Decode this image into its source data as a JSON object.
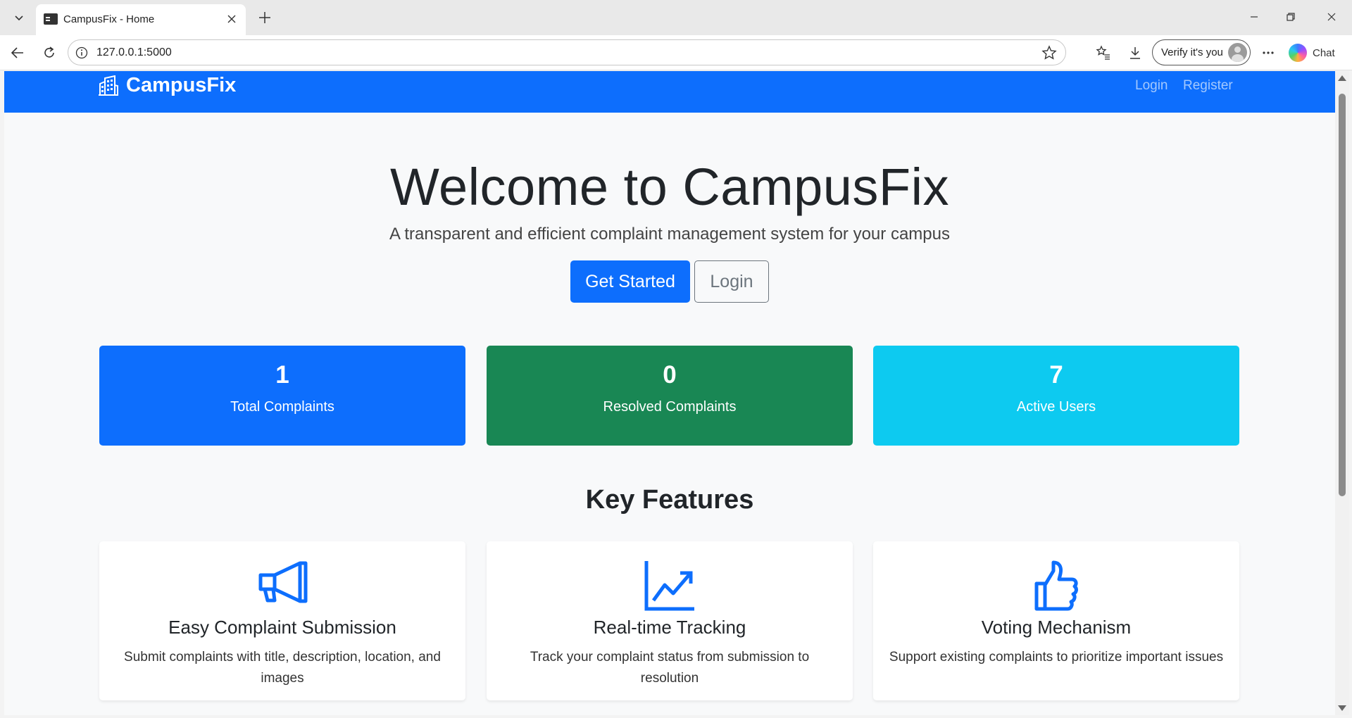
{
  "browser": {
    "tab_title": "CampusFix - Home",
    "url": "127.0.0.1:5000",
    "verify_label": "Verify it's you",
    "chat_label": "Chat"
  },
  "navbar": {
    "brand": "CampusFix",
    "links": [
      "Login",
      "Register"
    ]
  },
  "hero": {
    "title": "Welcome to CampusFix",
    "subtitle": "A transparent and efficient complaint management system for your campus",
    "primary_button": "Get Started",
    "secondary_button": "Login"
  },
  "stats": [
    {
      "value": "1",
      "label": "Total Complaints",
      "color": "#0d6efd"
    },
    {
      "value": "0",
      "label": "Resolved Complaints",
      "color": "#198754"
    },
    {
      "value": "7",
      "label": "Active Users",
      "color": "#0dcaf0"
    }
  ],
  "features": {
    "heading": "Key Features",
    "items": [
      {
        "icon": "megaphone-icon",
        "title": "Easy Complaint Submission",
        "text": "Submit complaints with title, description, location, and images"
      },
      {
        "icon": "graph-up-icon",
        "title": "Real-time Tracking",
        "text": "Track your complaint status from submission to resolution"
      },
      {
        "icon": "thumbs-up-icon",
        "title": "Voting Mechanism",
        "text": "Support existing complaints to prioritize important issues"
      }
    ]
  },
  "colors": {
    "primary": "#0d6efd",
    "success": "#198754",
    "info": "#0dcaf0",
    "page_bg": "#f8f9fa"
  }
}
